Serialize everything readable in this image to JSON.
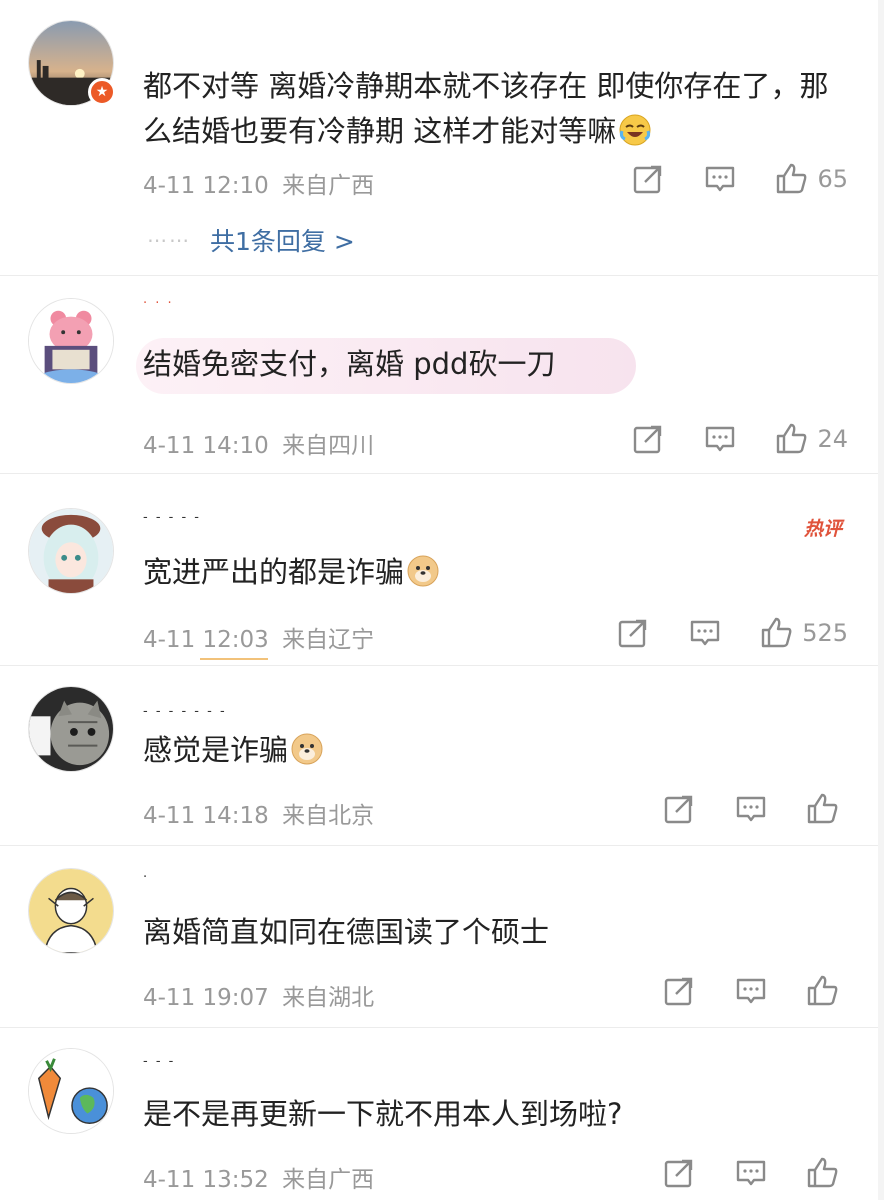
{
  "comments": [
    {
      "text": "都不对等 离婚冷静期本就不该存在 即使你存在了，那么结婚也要有冷静期 这样才能对等嘛",
      "emoji": "laughing-tears-emoji",
      "date": "4-11 12:10",
      "location": "来自广西",
      "likes": "65",
      "reply_link": "共1条回复 >",
      "reply_dots": "⋯⋯"
    },
    {
      "text": "结婚免密支付，离婚 pdd砍一刀",
      "date": "4-11 14:10",
      "location": "来自四川",
      "likes": "24"
    },
    {
      "text": "宽进严出的都是诈骗",
      "emoji": "doge-emoji",
      "badge": "热评",
      "date": "4-11 12:03",
      "location": "来自辽宁",
      "likes": "525"
    },
    {
      "text": "感觉是诈骗",
      "emoji": "doge-emoji",
      "date": "4-11 14:18",
      "location": "来自北京",
      "likes": ""
    },
    {
      "text": "离婚简直如同在德国读了个硕士",
      "date": "4-11 19:07",
      "location": "来自湖北",
      "likes": ""
    },
    {
      "text": "是不是再更新一下就不用本人到场啦?",
      "date": "4-11 13:52",
      "location": "来自广西",
      "likes": ""
    }
  ],
  "icons": {
    "share": "share-icon",
    "comment": "comment-icon",
    "like": "like-icon"
  },
  "colors": {
    "link": "#3f6ea3",
    "meta": "#999999",
    "hot": "#e0533b",
    "vip_badge": "#ec5a27"
  }
}
